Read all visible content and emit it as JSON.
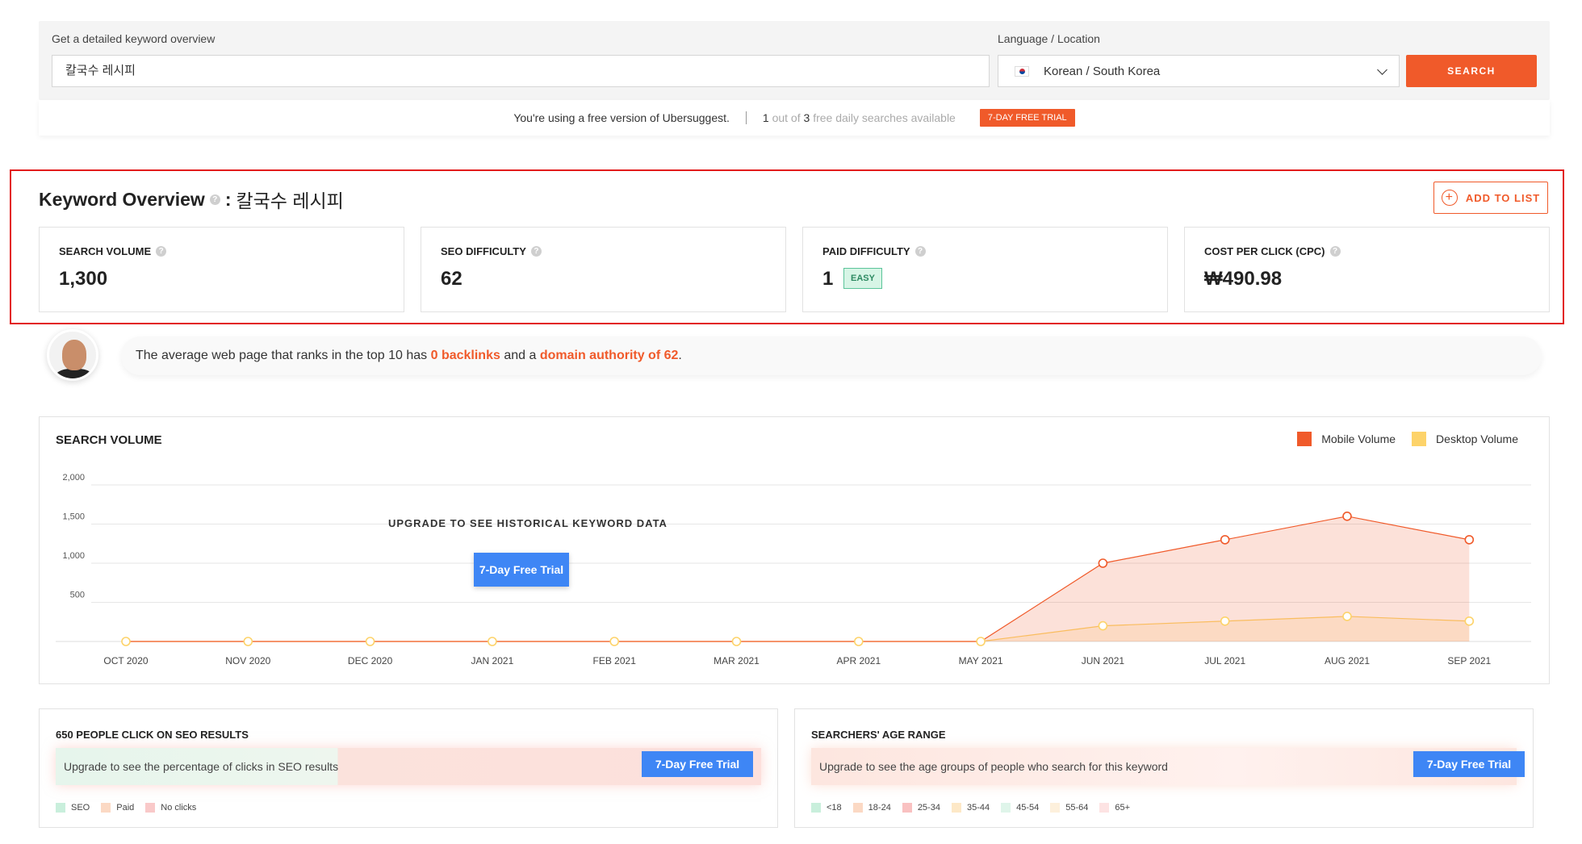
{
  "search": {
    "keyword_label": "Get a detailed keyword overview",
    "keyword_value": "칼국수 레시피",
    "language_label": "Language / Location",
    "language_value": "Korean / South Korea",
    "search_button": "SEARCH"
  },
  "free_notice": {
    "text": "You're using a free version of Ubersuggest.",
    "used": "1",
    "out_of": "out of",
    "total": "3",
    "suffix": "free daily searches available",
    "trial": "7-DAY FREE TRIAL"
  },
  "overview": {
    "title": "Keyword Overview",
    "colon": ":",
    "keyword": "칼국수 레시피",
    "add_to_list": "ADD TO LIST",
    "metrics": [
      {
        "label": "SEARCH VOLUME",
        "value": "1,300"
      },
      {
        "label": "SEO DIFFICULTY",
        "value": "62"
      },
      {
        "label": "PAID DIFFICULTY",
        "value": "1",
        "badge": "EASY"
      },
      {
        "label": "COST PER CLICK (CPC)",
        "value": "₩490.98"
      }
    ]
  },
  "banner": {
    "pre": "The average web page that ranks in the top 10 has",
    "backlinks": "0 backlinks",
    "mid": "and a",
    "authority": "domain authority of 62",
    "end": "."
  },
  "chart_data": {
    "type": "line",
    "title": "SEARCH VOLUME",
    "categories": [
      "OCT 2020",
      "NOV 2020",
      "DEC 2020",
      "JAN 2021",
      "FEB 2021",
      "MAR 2021",
      "APR 2021",
      "MAY 2021",
      "JUN 2021",
      "JUL 2021",
      "AUG 2021",
      "SEP 2021"
    ],
    "series": [
      {
        "name": "Mobile Volume",
        "color": "#f05a2a",
        "values": [
          0,
          0,
          0,
          0,
          0,
          0,
          0,
          0,
          1000,
          1300,
          1600,
          1300
        ]
      },
      {
        "name": "Desktop Volume",
        "color": "#fdd36a",
        "values": [
          0,
          0,
          0,
          0,
          0,
          0,
          0,
          0,
          200,
          260,
          320,
          260
        ]
      }
    ],
    "yticks": [
      "2,000",
      "1,500",
      "1,000",
      "500"
    ],
    "ylim": [
      0,
      2000
    ],
    "grid": true,
    "legend": "top-right",
    "upgrade_text": "UPGRADE TO SEE HISTORICAL KEYWORD DATA",
    "trial_button": "7-Day Free Trial"
  },
  "seo_clicks": {
    "title": "650 PEOPLE CLICK ON SEO RESULTS",
    "text": "Upgrade to see the percentage of clicks in SEO results",
    "trial_button": "7-Day Free Trial",
    "legend": [
      {
        "label": "SEO",
        "color": "#c9efdc"
      },
      {
        "label": "Paid",
        "color": "#fbd9c4"
      },
      {
        "label": "No clicks",
        "color": "#f9c9c9"
      }
    ]
  },
  "age_range": {
    "title": "SEARCHERS' AGE RANGE",
    "text": "Upgrade to see the age groups of people who search for this keyword",
    "trial_button": "7-Day Free Trial",
    "legend": [
      {
        "label": "<18",
        "color": "#c9efdc"
      },
      {
        "label": "18-24",
        "color": "#fbd9c4"
      },
      {
        "label": "25-34",
        "color": "#f9c1c1"
      },
      {
        "label": "35-44",
        "color": "#fde8c7"
      },
      {
        "label": "45-54",
        "color": "#dff5ea"
      },
      {
        "label": "55-64",
        "color": "#fdf0dc"
      },
      {
        "label": "65+",
        "color": "#fde3e3"
      }
    ]
  }
}
